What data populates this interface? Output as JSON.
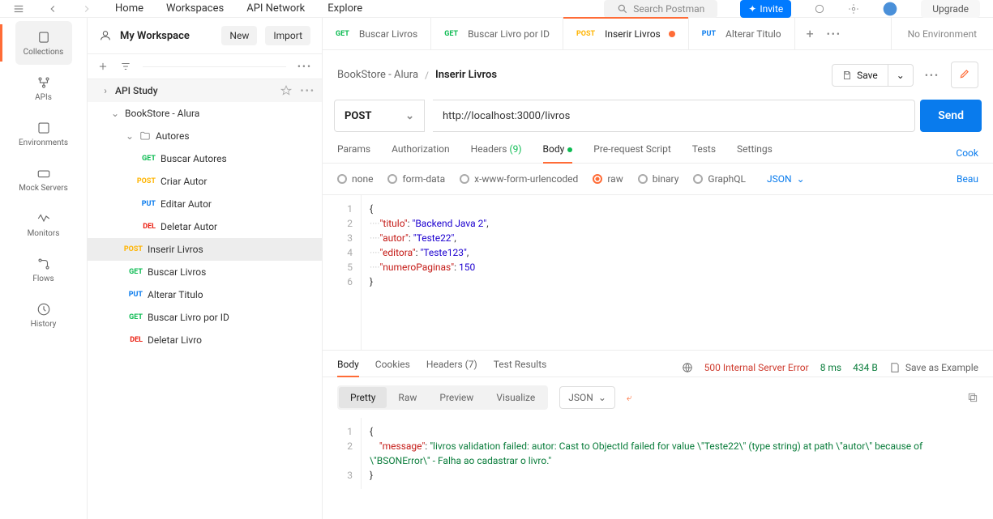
{
  "topnav": {
    "home": "Home",
    "workspaces": "Workspaces",
    "api_network": "API Network",
    "explore": "Explore",
    "search_placeholder": "Search Postman",
    "invite": "Invite",
    "upgrade": "Upgrade"
  },
  "rail": {
    "collections": "Collections",
    "apis": "APIs",
    "environments": "Environments",
    "mock": "Mock Servers",
    "monitors": "Monitors",
    "flows": "Flows",
    "history": "History"
  },
  "workspace": {
    "name": "My Workspace",
    "new_btn": "New",
    "import_btn": "Import"
  },
  "tree": {
    "root": "API Study",
    "coll": "BookStore - Alura",
    "folder": "Autores",
    "items": [
      {
        "method": "GET",
        "label": "Buscar Autores"
      },
      {
        "method": "POST",
        "label": "Criar Autor"
      },
      {
        "method": "PUT",
        "label": "Editar Autor"
      },
      {
        "method": "DEL",
        "label": "Deletar Autor"
      },
      {
        "method": "POST",
        "label": "Inserir Livros"
      },
      {
        "method": "GET",
        "label": "Buscar Livros"
      },
      {
        "method": "PUT",
        "label": "Alterar Titulo"
      },
      {
        "method": "GET",
        "label": "Buscar Livro por ID"
      },
      {
        "method": "DEL",
        "label": "Deletar Livro"
      }
    ]
  },
  "tabs": [
    {
      "method": "GET",
      "label": "Buscar Livros"
    },
    {
      "method": "GET",
      "label": "Buscar Livro por ID"
    },
    {
      "method": "POST",
      "label": "Inserir Livros",
      "dirty": true
    },
    {
      "method": "PUT",
      "label": "Alterar Titulo"
    }
  ],
  "env": "No Environment",
  "breadcrumb": {
    "parent": "BookStore - Alura",
    "current": "Inserir Livros",
    "save": "Save"
  },
  "request": {
    "method": "POST",
    "url": "http://localhost:3000/livros",
    "send": "Send"
  },
  "reqtabs": {
    "params": "Params",
    "auth": "Authorization",
    "headers": "Headers",
    "headers_count": "(9)",
    "body": "Body",
    "prescript": "Pre-request Script",
    "tests": "Tests",
    "settings": "Settings",
    "cookies": "Cook"
  },
  "bodytypes": {
    "none": "none",
    "form": "form-data",
    "url": "x-www-form-urlencoded",
    "raw": "raw",
    "binary": "binary",
    "graphql": "GraphQL",
    "format": "JSON",
    "beautify": "Beau"
  },
  "request_body": {
    "titulo": "Backend Java 2",
    "autor": "Teste22",
    "editora": "Teste123",
    "numeroPaginas": 150
  },
  "response": {
    "tabs": {
      "body": "Body",
      "cookies": "Cookies",
      "headers": "Headers",
      "headers_count": "(7)",
      "tests": "Test Results"
    },
    "status": "500 Internal Server Error",
    "time": "8 ms",
    "size": "434 B",
    "save_example": "Save as Example",
    "viewmodes": {
      "pretty": "Pretty",
      "raw": "Raw",
      "preview": "Preview",
      "visualize": "Visualize"
    },
    "format": "JSON",
    "body": {
      "message": "livros validation failed: autor: Cast to ObjectId failed for value \\\"Teste22\\\" (type string) at path \\\"autor\\\" because of \\\"BSONError\\\" - Falha ao cadastrar o livro."
    }
  }
}
